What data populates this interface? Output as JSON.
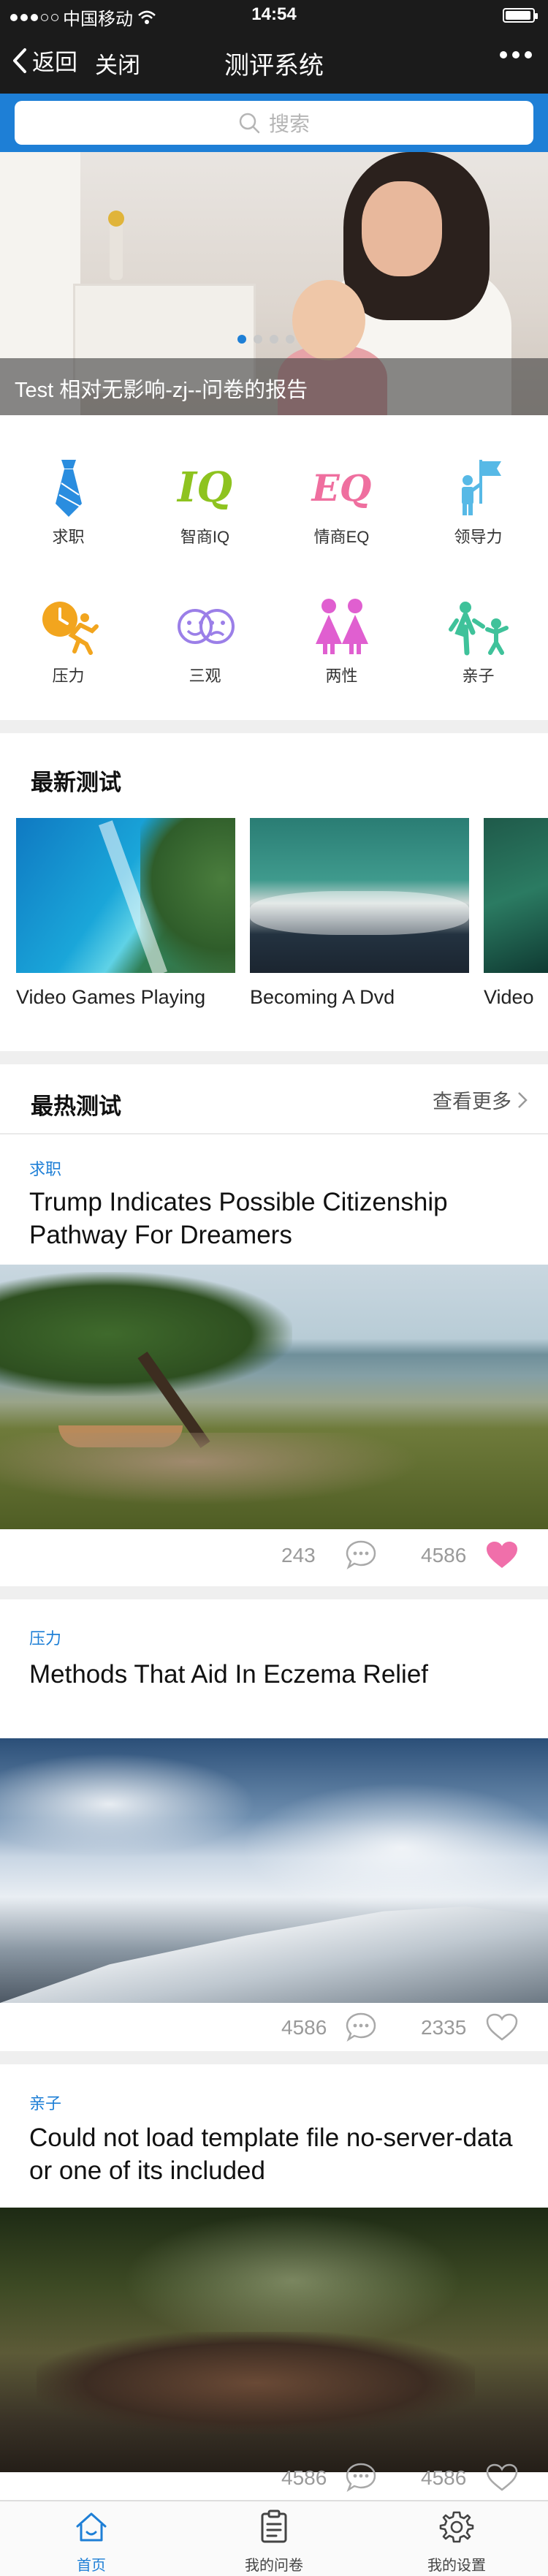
{
  "status_bar": {
    "carrier": "中国移动",
    "time": "14:54"
  },
  "nav": {
    "back_label": "返回",
    "close_label": "关闭",
    "title": "测评系统"
  },
  "search": {
    "placeholder": "搜索"
  },
  "banner": {
    "caption": "Test 相对无影响-zj--问卷的报告",
    "slide_count": 4,
    "active_slide": 1
  },
  "categories": [
    {
      "label": "求职",
      "icon": "necktie-icon",
      "color": "#2a8ddf"
    },
    {
      "label": "智商IQ",
      "icon": "iq-icon",
      "icon_text": "IQ",
      "color": "#8ec31f"
    },
    {
      "label": "情商EQ",
      "icon": "eq-icon",
      "icon_text": "EQ",
      "color": "#ef6f9f"
    },
    {
      "label": "领导力",
      "icon": "leader-flag-icon",
      "color": "#57b9e6"
    },
    {
      "label": "压力",
      "icon": "clock-runner-icon",
      "color": "#f2a51e"
    },
    {
      "label": "三观",
      "icon": "faces-icon",
      "color": "#9b7fe8"
    },
    {
      "label": "两性",
      "icon": "couple-icon",
      "color": "#e05fd0"
    },
    {
      "label": "亲子",
      "icon": "family-icon",
      "color": "#3fc29a"
    }
  ],
  "newest": {
    "title": "最新测试",
    "items": [
      {
        "title": "Video Games Playing"
      },
      {
        "title": "Becoming A Dvd"
      },
      {
        "title": "Video"
      }
    ]
  },
  "hottest": {
    "title": "最热测试",
    "more_label": "查看更多",
    "items": [
      {
        "tag": "求职",
        "title": "Trump Indicates Possible Citizenship Pathway For Dreamers",
        "comments": "243",
        "likes": "4586",
        "liked": true
      },
      {
        "tag": "压力",
        "title": "Methods That Aid In Eczema Relief",
        "comments": "4586",
        "likes": "2335",
        "liked": false
      },
      {
        "tag": "亲子",
        "title": "Could not load template file no-server-data or one of its included",
        "comments": "4586",
        "likes": "4586",
        "liked": false
      }
    ]
  },
  "tab_bar": {
    "tabs": [
      {
        "label": "首页",
        "active": true
      },
      {
        "label": "我的问卷",
        "active": false
      },
      {
        "label": "我的设置",
        "active": false
      }
    ]
  },
  "colors": {
    "accent": "#1e7fd6",
    "nav_bg": "#1b1b1b",
    "like_active": "#f06faa"
  }
}
